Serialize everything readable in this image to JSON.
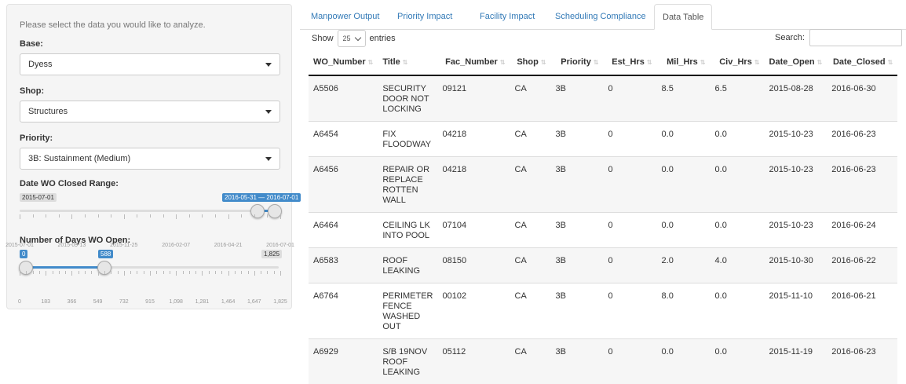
{
  "sidebar": {
    "intro": "Please select the data you would like to analyze.",
    "base": {
      "label": "Base:",
      "value": "Dyess"
    },
    "shop": {
      "label": "Shop:",
      "value": "Structures"
    },
    "priority": {
      "label": "Priority:",
      "value": "3B: Sustainment (Medium)"
    },
    "date_range": {
      "label": "Date WO Closed Range:",
      "min_label": "2015-07-01",
      "selected_label": "2016-05-31 — 2016-07-01",
      "ticks": [
        "2015-07-01",
        "2015-09-13",
        "2015-11-25",
        "2016-02-07",
        "2016-04-21",
        "2016-07-01"
      ]
    },
    "days_open": {
      "label": "Number of Days WO Open:",
      "from_label": "0",
      "to_label": "588",
      "max_label": "1,825",
      "ticks": [
        "0",
        "183",
        "366",
        "549",
        "732",
        "915",
        "1,098",
        "1,281",
        "1,464",
        "1,647",
        "1,825"
      ]
    }
  },
  "tabs": [
    "Manpower Output",
    "Priority Impact",
    "Facility Impact",
    "Scheduling Compliance",
    "Data Table"
  ],
  "active_tab": "Data Table",
  "table_controls": {
    "show": "Show",
    "length": "25",
    "entries": "entries",
    "search_label": "Search:"
  },
  "table": {
    "columns": [
      "WO_Number",
      "Title",
      "Fac_Number",
      "Shop",
      "Priority",
      "Est_Hrs",
      "Mil_Hrs",
      "Civ_Hrs",
      "Date_Open",
      "Date_Closed"
    ],
    "rows": [
      {
        "wo": "A5506",
        "title": "SECURITY DOOR NOT LOCKING",
        "fac": "09121",
        "shop": "CA",
        "pri": "3B",
        "est": "0",
        "mil": "8.5",
        "civ": "6.5",
        "open": "2015-08-28",
        "closed": "2016-06-30"
      },
      {
        "wo": "A6454",
        "title": "FIX FLOODWAY",
        "fac": "04218",
        "shop": "CA",
        "pri": "3B",
        "est": "0",
        "mil": "0.0",
        "civ": "0.0",
        "open": "2015-10-23",
        "closed": "2016-06-23"
      },
      {
        "wo": "A6456",
        "title": "REPAIR OR REPLACE ROTTEN WALL",
        "fac": "04218",
        "shop": "CA",
        "pri": "3B",
        "est": "0",
        "mil": "0.0",
        "civ": "0.0",
        "open": "2015-10-23",
        "closed": "2016-06-23"
      },
      {
        "wo": "A6464",
        "title": "CEILING LK INTO POOL",
        "fac": "07104",
        "shop": "CA",
        "pri": "3B",
        "est": "0",
        "mil": "0.0",
        "civ": "0.0",
        "open": "2015-10-23",
        "closed": "2016-06-24"
      },
      {
        "wo": "A6583",
        "title": "ROOF LEAKING",
        "fac": "08150",
        "shop": "CA",
        "pri": "3B",
        "est": "0",
        "mil": "2.0",
        "civ": "4.0",
        "open": "2015-10-30",
        "closed": "2016-06-22"
      },
      {
        "wo": "A6764",
        "title": "PERIMETER FENCE WASHED OUT",
        "fac": "00102",
        "shop": "CA",
        "pri": "3B",
        "est": "0",
        "mil": "8.0",
        "civ": "0.0",
        "open": "2015-11-10",
        "closed": "2016-06-21"
      },
      {
        "wo": "A6929",
        "title": "S/B 19NOV ROOF LEAKING",
        "fac": "05112",
        "shop": "CA",
        "pri": "3B",
        "est": "0",
        "mil": "0.0",
        "civ": "0.0",
        "open": "2015-11-19",
        "closed": "2016-06-23"
      }
    ]
  },
  "colors": {
    "accent": "#428bca",
    "link": "#337ab7",
    "stripe": "#f6f6f6"
  }
}
